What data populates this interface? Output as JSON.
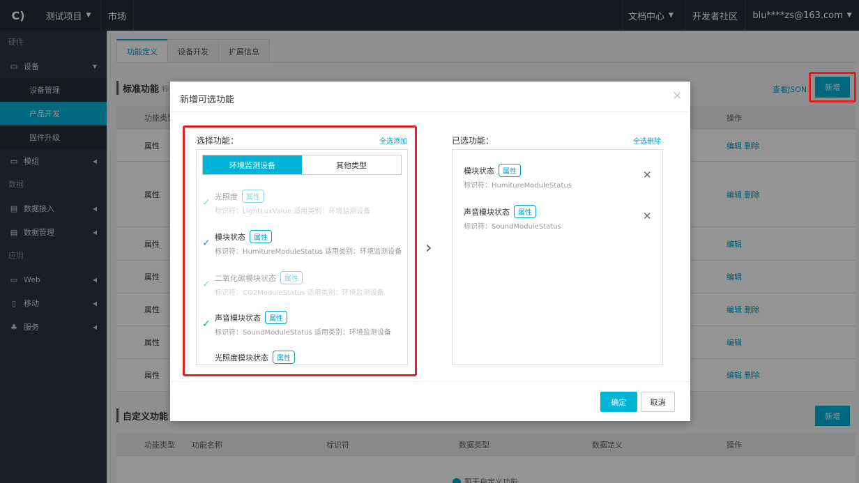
{
  "topbar": {
    "logo": "C)",
    "project": "测试项目",
    "market": "市场",
    "docs": "文档中心",
    "community": "开发者社区",
    "user": "blu****zs@163.com"
  },
  "sidebar": {
    "section_hardware": "硬件",
    "device": "设备",
    "device_mgmt": "设备管理",
    "product_dev": "产品开发",
    "firmware": "固件升级",
    "module": "模组",
    "section_data": "数据",
    "data_access": "数据接入",
    "data_mgmt": "数据管理",
    "section_app": "应用",
    "web": "Web",
    "mobile": "移动",
    "service": "服务"
  },
  "main": {
    "tabs": [
      {
        "label": "功能定义"
      },
      {
        "label": "设备开发"
      },
      {
        "label": "扩展信息"
      }
    ],
    "standard_title": "标准功能",
    "standard_sub": "标",
    "view_json": "查看JSON",
    "add_label": "新增",
    "table_head_type": "功能类型",
    "ops_head": "操作",
    "edit": "编辑",
    "delete": "删除",
    "rows": [
      {
        "type": "属性",
        "ops": "编辑 删除"
      },
      {
        "type": "属性",
        "ops": "编辑 删除"
      },
      {
        "type": "属性",
        "ops": "编辑"
      },
      {
        "type": "属性",
        "ops": "编辑"
      },
      {
        "type": "属性",
        "ops": "编辑 删除"
      },
      {
        "type": "属性",
        "ops": "编辑"
      },
      {
        "type": "属性",
        "ops": "编辑 删除"
      }
    ],
    "custom_title": "自定义功能",
    "custom_add": "新增",
    "custom_headers": [
      "功能类型",
      "功能名称",
      "标识符",
      "数据类型",
      "数据定义",
      "操作"
    ],
    "empty_hint": "暂无自定义功能"
  },
  "modal": {
    "title": "新增可选功能",
    "close": "×",
    "left_label": "选择功能：",
    "select_all": "全选添加",
    "seg_env": "环境监测设备",
    "seg_other": "其他类型",
    "options": [
      {
        "name": "光照度",
        "tag": "属性",
        "meta": "标识符：LightLuxValue  适用类别：环境监测设备"
      },
      {
        "name": "模块状态",
        "tag": "属性",
        "meta": "标识符：HumitureModuleStatus  适用类别：环境监测设备"
      },
      {
        "name": "二氧化碳模块状态",
        "tag": "属性",
        "meta": "标识符：CO2ModuleStatus  适用类别：环境监测设备"
      },
      {
        "name": "声音模块状态",
        "tag": "属性",
        "meta": "标识符：SoundModuleStatus  适用类别：环境监测设备"
      },
      {
        "name": "光照度模块状态",
        "tag": "属性",
        "meta": ""
      }
    ],
    "right_label": "已选功能：",
    "remove_all": "全选删除",
    "selected": [
      {
        "name": "模块状态",
        "tag": "属性",
        "meta": "标识符：HumitureModuleStatus"
      },
      {
        "name": "声音模块状态",
        "tag": "属性",
        "meta": "标识符：SoundModuleStatus"
      }
    ],
    "ok": "确定",
    "cancel": "取消"
  },
  "colors": {
    "accent": "#00b4d8",
    "highlight": "#e02020",
    "topbar": "#262b34",
    "sidebar": "#2f3441"
  }
}
